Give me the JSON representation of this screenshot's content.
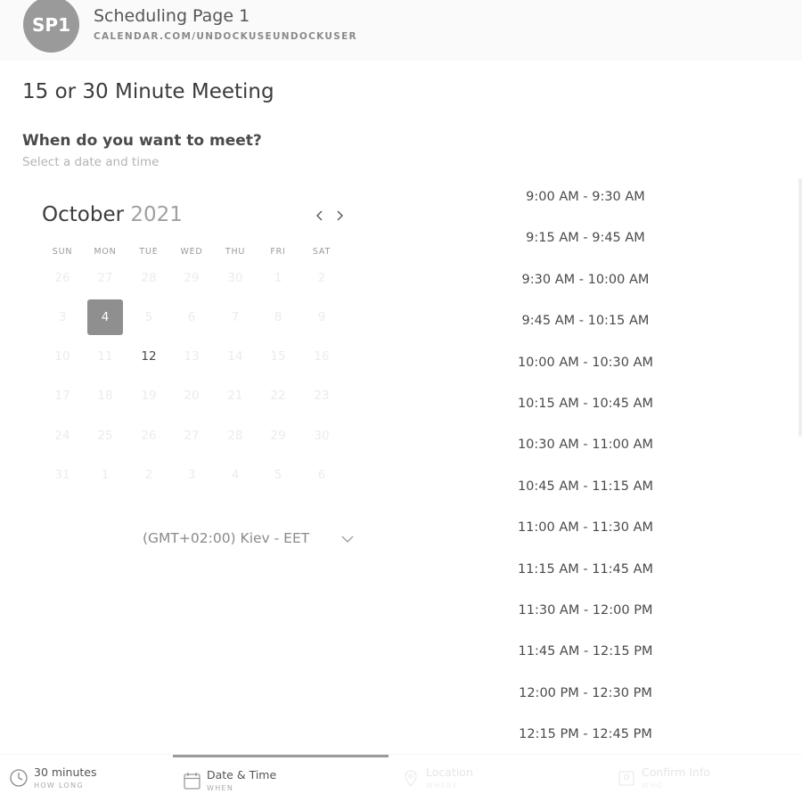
{
  "header": {
    "avatar_initials": "SP1",
    "page_name": "Scheduling Page 1",
    "page_url": "CALENDAR.COM/UNDOCKUSEUNDOCKUSER"
  },
  "meeting": {
    "title": "15 or 30 Minute Meeting",
    "question": "When do you want to meet?",
    "subquestion": "Select a date and time"
  },
  "calendar": {
    "month": "October",
    "year": "2021",
    "weekdays": [
      "SUN",
      "MON",
      "TUE",
      "WED",
      "THU",
      "FRI",
      "SAT"
    ],
    "selected_day": "4",
    "available_day": "12",
    "rows": [
      [
        "26",
        "27",
        "28",
        "29",
        "30",
        "1",
        "2"
      ],
      [
        "3",
        "4",
        "5",
        "6",
        "7",
        "8",
        "9"
      ],
      [
        "10",
        "11",
        "12",
        "13",
        "14",
        "15",
        "16"
      ],
      [
        "17",
        "18",
        "19",
        "20",
        "21",
        "22",
        "23"
      ],
      [
        "24",
        "25",
        "26",
        "27",
        "28",
        "29",
        "30"
      ],
      [
        "31",
        "1",
        "2",
        "3",
        "4",
        "5",
        "6"
      ]
    ]
  },
  "timezone": {
    "label": "(GMT+02:00) Kiev - EET"
  },
  "time_slots": [
    "9:00 AM - 9:30 AM",
    "9:15 AM - 9:45 AM",
    "9:30 AM - 10:00 AM",
    "9:45 AM - 10:15 AM",
    "10:00 AM - 10:30 AM",
    "10:15 AM - 10:45 AM",
    "10:30 AM - 11:00 AM",
    "10:45 AM - 11:15 AM",
    "11:00 AM - 11:30 AM",
    "11:15 AM - 11:45 AM",
    "11:30 AM - 12:00 PM",
    "11:45 AM - 12:15 PM",
    "12:00 PM - 12:30 PM",
    "12:15 PM - 12:45 PM"
  ],
  "steps": [
    {
      "label": "30 minutes",
      "sub": "HOW LONG",
      "icon": "clock-icon"
    },
    {
      "label": "Date & Time",
      "sub": "WHEN",
      "icon": "calendar-icon"
    },
    {
      "label": "Location",
      "sub": "WHERE",
      "icon": "location-pin-icon"
    },
    {
      "label": "Confirm Info",
      "sub": "WHO",
      "icon": "user-card-icon"
    }
  ],
  "colors": {
    "selected_day_bg": "#8f8f8f",
    "active_step_border": "#9a9a9a",
    "faded_text": "#ececec"
  }
}
